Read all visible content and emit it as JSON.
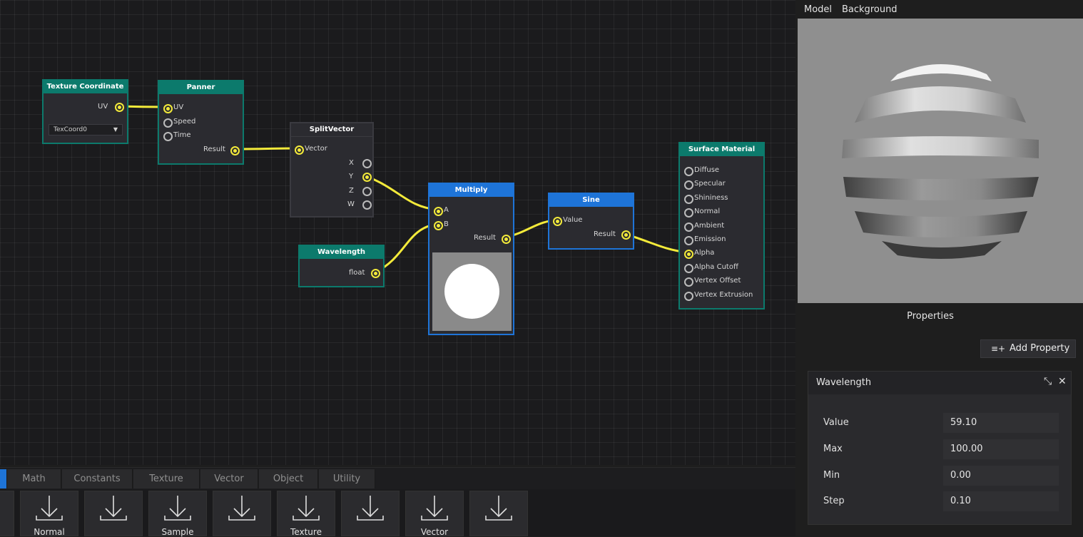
{
  "colors": {
    "teal": "#0c7a6c",
    "blue": "#1e74d8",
    "wire": "#f3ea3a",
    "grid_bg": "#1b1b1d"
  },
  "nodes": {
    "texcoord": {
      "title": "Texture Coordinate",
      "out": "UV",
      "dropdown": "TexCoord0"
    },
    "panner": {
      "title": "Panner",
      "in1": "UV",
      "in2": "Speed",
      "in3": "Time",
      "out": "Result"
    },
    "split": {
      "title": "SplitVector",
      "in": "Vector",
      "x": "X",
      "y": "Y",
      "z": "Z",
      "w": "W"
    },
    "wavelength": {
      "title": "Wavelength",
      "out": "float"
    },
    "multiply": {
      "title": "Multiply",
      "a": "A",
      "b": "B",
      "out": "Result"
    },
    "sine": {
      "title": "Sine",
      "in": "Value",
      "out": "Result"
    },
    "surface": {
      "title": "Surface Material",
      "inputs": [
        "Diffuse",
        "Specular",
        "Shininess",
        "Normal",
        "Ambient",
        "Emission",
        "Alpha",
        "Alpha Cutoff",
        "Vertex Offset",
        "Vertex Extrusion"
      ]
    }
  },
  "right": {
    "menu": {
      "model": "Model",
      "background": "Background"
    },
    "properties_title": "Properties",
    "add_property": "Add Property",
    "card": {
      "title": "Wavelength",
      "rows": [
        {
          "label": "Value",
          "value": "59.10"
        },
        {
          "label": "Max",
          "value": "100.00"
        },
        {
          "label": "Min",
          "value": "0.00"
        },
        {
          "label": "Step",
          "value": "0.10"
        }
      ]
    }
  },
  "tabs": [
    "Math",
    "Constants",
    "Texture",
    "Vector",
    "Object",
    "Utility"
  ],
  "palette": [
    "",
    "Normal",
    "",
    "Sample",
    "",
    "Texture",
    "",
    "Vector",
    ""
  ],
  "icons": {
    "palette_item": "download-arrow-icon",
    "add_property": "playlist-add-icon",
    "minimize": "collapse-arrows-icon",
    "close": "close-icon"
  }
}
